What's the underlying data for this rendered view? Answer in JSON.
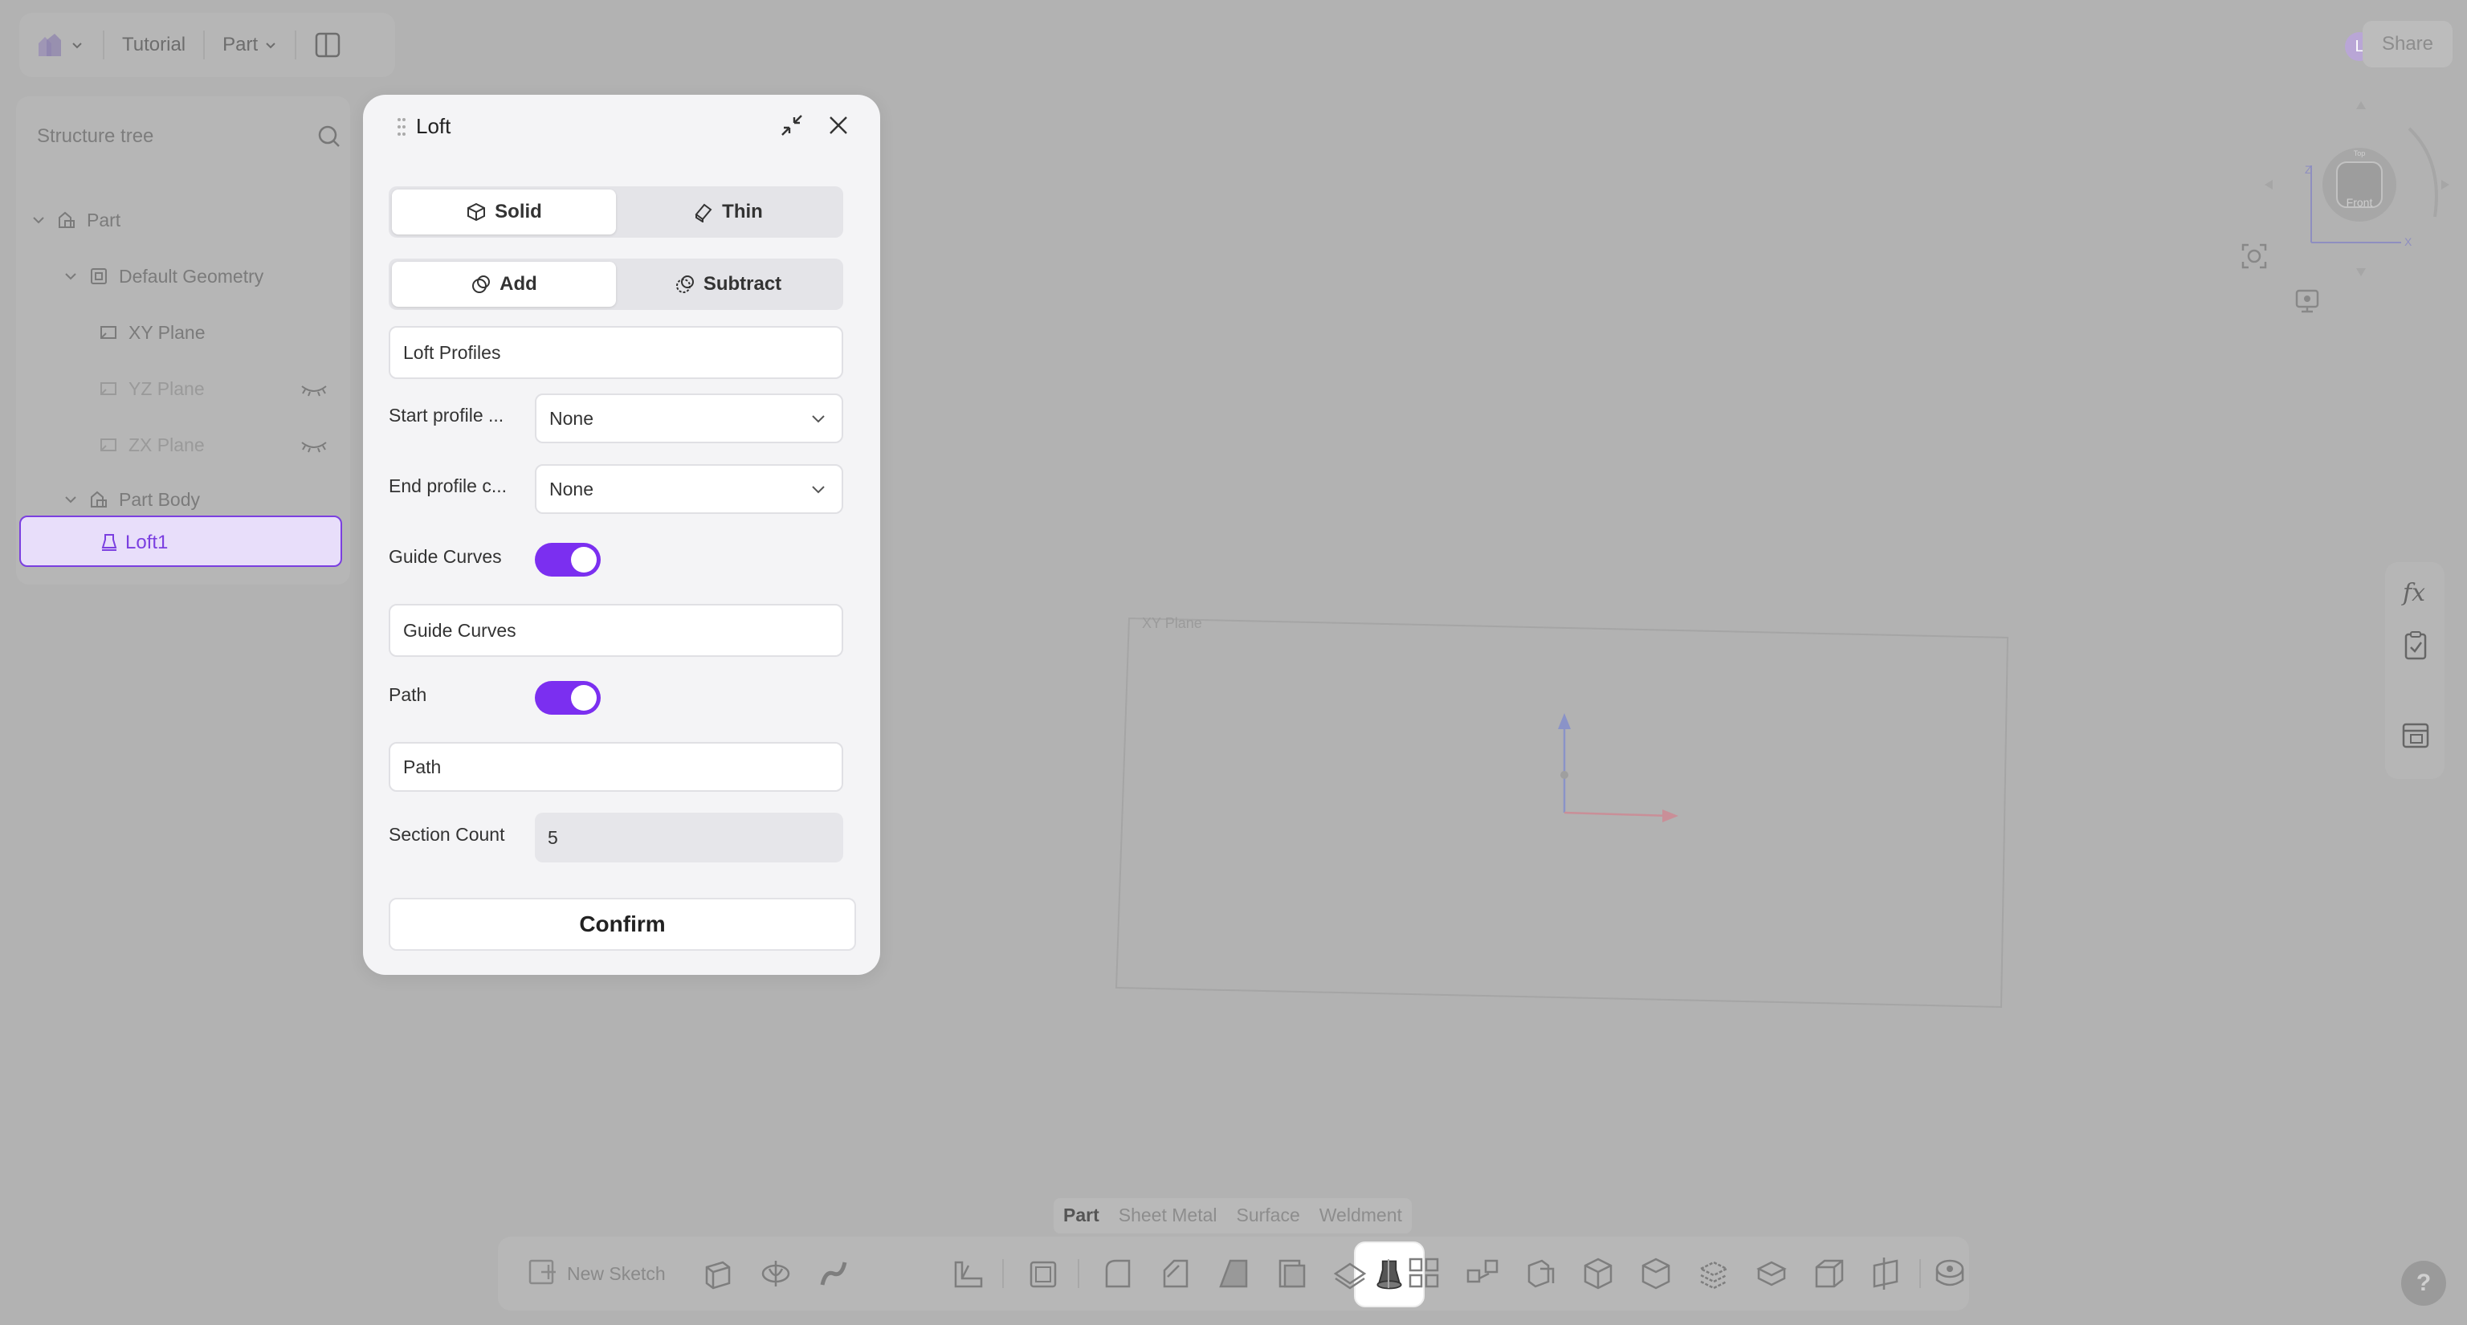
{
  "topbar": {
    "project": "Tutorial",
    "mode": "Part"
  },
  "tree": {
    "search_placeholder": "Structure tree",
    "items": [
      {
        "label": "Part"
      },
      {
        "label": "Default Geometry"
      },
      {
        "label": "XY Plane"
      },
      {
        "label": "YZ Plane"
      },
      {
        "label": "ZX Plane"
      },
      {
        "label": "Part Body"
      },
      {
        "label": "Loft1"
      }
    ]
  },
  "dialog": {
    "title": "Loft",
    "type_options": [
      "Solid",
      "Thin"
    ],
    "type_selected": "Solid",
    "operation_options": [
      "Add",
      "Subtract"
    ],
    "operation_selected": "Add",
    "loft_profiles": "Loft Profiles",
    "start_profile_label": "Start profile ...",
    "start_profile_value": "None",
    "end_profile_label": "End profile c...",
    "end_profile_value": "None",
    "guide_curves_label": "Guide Curves",
    "guide_curves_enabled": true,
    "guide_curves_field": "Guide Curves",
    "path_label": "Path",
    "path_enabled": true,
    "path_field": "Path",
    "section_count_label": "Section Count",
    "section_count_value": "5",
    "confirm_label": "Confirm"
  },
  "viewport": {
    "plane_label": "XY Plane",
    "view_cube_face": "Front",
    "view_cube_top": "Top"
  },
  "header_right": {
    "avatar_initial": "L",
    "share_label": "Share"
  },
  "bottom": {
    "tabs": [
      "Part",
      "Sheet Metal",
      "Surface",
      "Weldment"
    ],
    "active_tab": "Part",
    "new_sketch_label": "New Sketch"
  },
  "help_label": "?",
  "colors": {
    "accent": "#7b2ff0",
    "canvas": "#b2b2b2",
    "dialog_bg": "#f4f4f6"
  }
}
